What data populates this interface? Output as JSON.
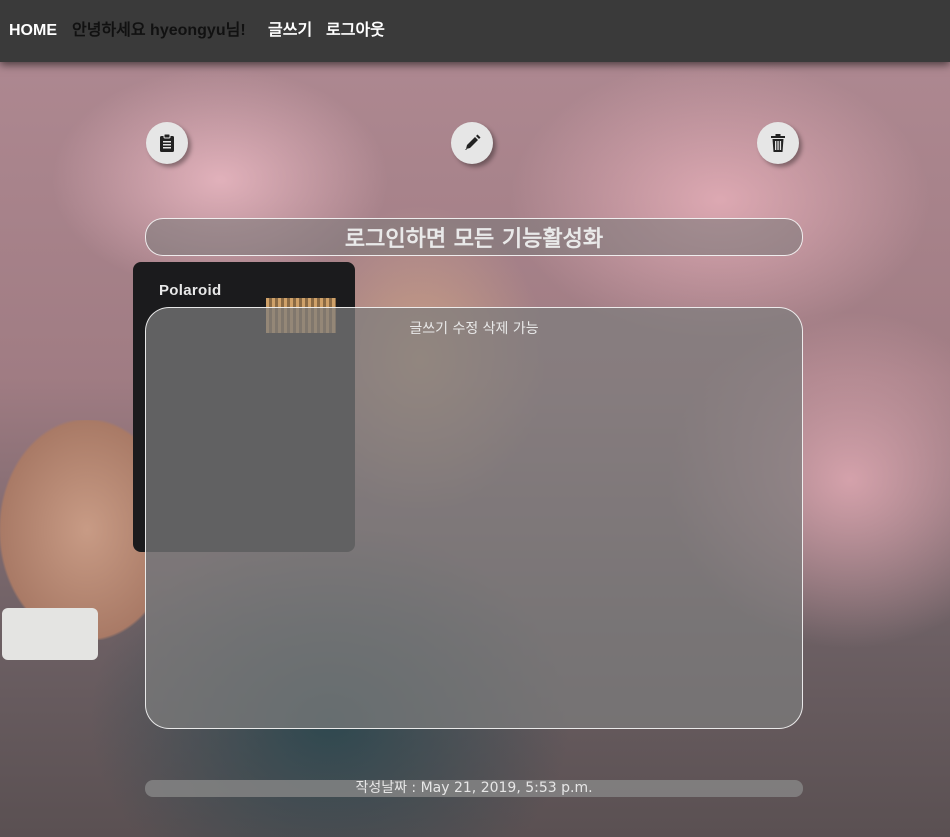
{
  "nav": {
    "home": "HOME",
    "greeting": "안녕하세요 hyeongyu님!",
    "write": "글쓰기",
    "logout": "로그아웃"
  },
  "background": {
    "camera_brand": "Polaroid"
  },
  "actions": {
    "list_icon": "clipboard-icon",
    "edit_icon": "pencil-icon",
    "delete_icon": "trash-icon"
  },
  "post": {
    "title": "로그인하면 모든 기능활성화",
    "content": "글쓰기 수정 삭제 가능",
    "date_label": "작성날짜 : May 21, 2019, 5:53 p.m."
  },
  "colors": {
    "navbar": "#3a3a3a",
    "panel": "#7d7d7d",
    "text_light": "#e9e9e9"
  }
}
